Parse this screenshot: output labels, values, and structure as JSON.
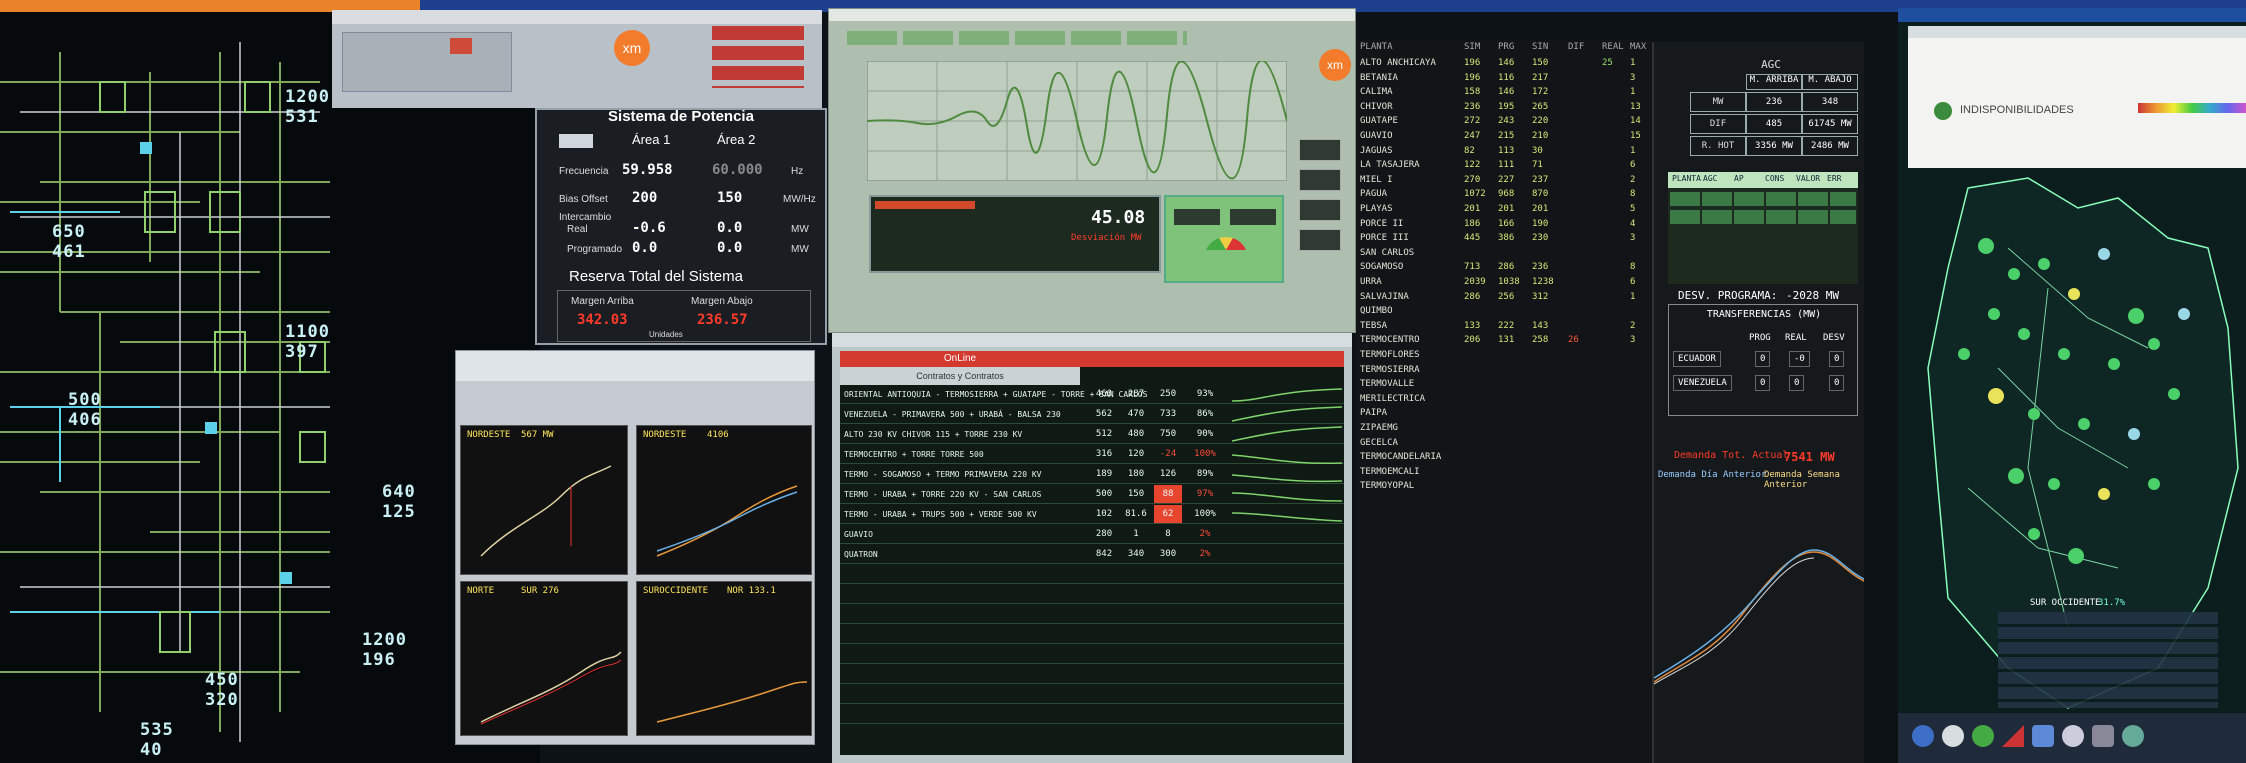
{
  "sld": {
    "readouts": [
      {
        "top": "1200",
        "bot": "531"
      },
      {
        "top": "650",
        "bot": "461"
      },
      {
        "top": "1100",
        "bot": "397"
      },
      {
        "top": "500",
        "bot": "406"
      },
      {
        "top": "640",
        "bot": "125"
      },
      {
        "top": "1200",
        "bot": "196"
      },
      {
        "top": "450",
        "bot": "320"
      },
      {
        "top": "535",
        "bot": "40"
      }
    ]
  },
  "agc_panel": {
    "title": "Sistema de Potencia",
    "area1": "Área 1",
    "area2": "Área 2",
    "freq_label": "Frecuencia",
    "freq_area1": "59.958",
    "freq_area2": "60.000",
    "freq_unit": "Hz",
    "bias_label": "Bias Offset",
    "bias_area1": "200",
    "bias_area2": "150",
    "bias_unit": "MW/Hz",
    "inter_label": "Intercambio",
    "real_label": "Real",
    "real_area1": "-0.6",
    "real_area2": "0.0",
    "real_unit": "MW",
    "prog_label": "Programado",
    "prog_area1": "0.0",
    "prog_area2": "0.0",
    "prog_unit": "MW",
    "reserve_title": "Reserva Total del Sistema",
    "margin_up_label": "Margen Arriba",
    "margin_down_label": "Margen Abajo",
    "margin_up": "342.03",
    "margin_down": "236.57",
    "footer": "Unidades"
  },
  "trend_window": {
    "logo": "xm",
    "readout": "45.08",
    "readout_sub": "Desviación MW"
  },
  "online_window": {
    "title": "OnLine",
    "subtitle": "Contratos y Contratos",
    "rows": [
      {
        "label": "ORIENTAL ANTIOQUIA - TERMOSIERRA + GUATAPE - TORRE + SAN CARLOS",
        "c1": "460",
        "c2": "287",
        "c3": "250",
        "c4": "93%"
      },
      {
        "label": "VENEZUELA - PRIMAVERA 500 + URABÁ - BALSA 230",
        "c1": "562",
        "c2": "470",
        "c3": "733",
        "c4": "86%"
      },
      {
        "label": "ALTO 230 KV CHIVOR 115 + TORRE 230 KV",
        "c1": "512",
        "c2": "480",
        "c3": "750",
        "c4": "90%"
      },
      {
        "label": "TERMOCENTRO + TORRE TORRE 500",
        "c1": "316",
        "c2": "120",
        "c3": "-24",
        "c4": "100%"
      },
      {
        "label": "TERMO - SOGAMOSO + TERMO PRIMAVERA 220 KV",
        "c1": "189",
        "c2": "180",
        "c3": "126",
        "c4": "89%"
      },
      {
        "label": "TERMO - URABA + TORRE 220 KV - SAN CARLOS",
        "c1": "500",
        "c2": "150",
        "c3": "88",
        "c4": "97%"
      },
      {
        "label": "TERMO - URABA + TRUPS 500 + VERDE 500 KV",
        "c1": "102",
        "c2": "81.6",
        "c3": "62",
        "c4": "100%"
      },
      {
        "label": "GUAVIO",
        "c1": "280",
        "c2": "1",
        "c3": "8",
        "c4": "2%"
      },
      {
        "label": "QUATRON",
        "c1": "842",
        "c2": "340",
        "c3": "300",
        "c4": "2%"
      }
    ]
  },
  "charts_window": {
    "labels": [
      "NORDESTE",
      "NORDESTE",
      "NORTE",
      "SUROCCIDENTE"
    ],
    "values": [
      "567 MW",
      "4106",
      "SUR 276",
      "NOR 133.1"
    ]
  },
  "plants_table": {
    "headers": [
      "PLANTA",
      "SIM",
      "PRG",
      "SIN",
      "DIF",
      "REAL",
      "MAX"
    ],
    "rows": [
      [
        "ALTO ANCHICAYA",
        "196",
        "146",
        "150",
        "",
        "25",
        "1"
      ],
      [
        "BETANIA",
        "196",
        "116",
        "217",
        "",
        "",
        "3"
      ],
      [
        "CALIMA",
        "158",
        "146",
        "172",
        "",
        "",
        "1"
      ],
      [
        "CHIVOR",
        "236",
        "195",
        "265",
        "",
        "",
        "13"
      ],
      [
        "GUATAPE",
        "272",
        "243",
        "220",
        "",
        "",
        "14"
      ],
      [
        "GUAVIO",
        "247",
        "215",
        "210",
        "",
        "",
        "15"
      ],
      [
        "JAGUAS",
        "82",
        "113",
        "30",
        "",
        "",
        "1"
      ],
      [
        "LA TASAJERA",
        "122",
        "111",
        "71",
        "",
        "",
        "6"
      ],
      [
        "MIEL I",
        "270",
        "227",
        "237",
        "",
        "",
        "2"
      ],
      [
        "PAGUA",
        "1072",
        "968",
        "870",
        "",
        "",
        "8"
      ],
      [
        "PLAYAS",
        "201",
        "201",
        "201",
        "",
        "",
        "5"
      ],
      [
        "PORCE II",
        "186",
        "166",
        "190",
        "",
        "",
        "4"
      ],
      [
        "PORCE III",
        "445",
        "386",
        "230",
        "",
        "",
        "3"
      ],
      [
        "SAN CARLOS",
        "",
        "",
        "",
        "",
        "",
        ""
      ],
      [
        "SOGAMOSO",
        "713",
        "286",
        "236",
        "",
        "",
        "8"
      ],
      [
        "URRA",
        "2039",
        "1038",
        "1238",
        "",
        "",
        "6"
      ],
      [
        "SALVAJINA",
        "286",
        "256",
        "312",
        "",
        "",
        "1"
      ],
      [
        "QUIMBO",
        "",
        "",
        "",
        "",
        "",
        ""
      ],
      [
        "TEBSA",
        "133",
        "222",
        "143",
        "",
        "",
        "2"
      ],
      [
        "TERMOCENTRO",
        "206",
        "131",
        "258",
        "26",
        "",
        "3"
      ],
      [
        "TERMOFLORES",
        "",
        "",
        "",
        "",
        "",
        ""
      ],
      [
        "TERMOSIERRA",
        "",
        "",
        "",
        "",
        "",
        ""
      ],
      [
        "TERMOVALLE",
        "",
        "",
        "",
        "",
        "",
        ""
      ],
      [
        "MERILECTRICA",
        "",
        "",
        "",
        "",
        "",
        ""
      ],
      [
        "PAIPA",
        "",
        "",
        "",
        "",
        "",
        ""
      ],
      [
        "ZIPAEMG",
        "",
        "",
        "",
        "",
        "",
        ""
      ],
      [
        "GECELCA",
        "",
        "",
        "",
        "",
        "",
        ""
      ],
      [
        "TERMOCANDELARIA",
        "",
        "",
        "",
        "",
        "",
        ""
      ],
      [
        "TERMOEMCALI",
        "",
        "",
        "",
        "",
        "",
        ""
      ],
      [
        "TERMOYOPAL",
        "",
        "",
        "",
        "",
        "",
        ""
      ]
    ]
  },
  "right_panel": {
    "agc_title": "AGC",
    "agc_cols": [
      "M. ARRIBA",
      "M. ABAJO"
    ],
    "agc_rows": [
      {
        "label": "MW",
        "a": "236",
        "b": "348"
      },
      {
        "label": "DIF",
        "a": "485",
        "b": "61745 MW"
      },
      {
        "label": "R. HOT",
        "a": "3356 MW",
        "b": "2486 MW"
      }
    ],
    "plant_cols": [
      "PLANTA",
      "AGC",
      "AP",
      "CONS",
      "VALOR",
      "ERR"
    ],
    "desv_label": "DESV. PROGRAMA:",
    "desv_value": "-2028 MW",
    "transfer_title": "TRANSFERENCIAS (MW)",
    "transfer_cols": [
      "PROG",
      "REAL",
      "DESV"
    ],
    "transfer_rows": [
      {
        "label": "ECUADOR",
        "prog": "0",
        "real": "-0",
        "desv": "0"
      },
      {
        "label": "VENEZUELA",
        "prog": "0",
        "real": "0",
        "desv": "0"
      }
    ],
    "demand_label": "Demanda Tot. Actual",
    "demand_value": "7541 MW",
    "demand_prev": "Demanda Día Anterior",
    "demand_prev2": "Demanda Semana Anterior"
  },
  "map_panel": {
    "title": "INDISPONIBILIDADES",
    "legend_title": "SUR OCCIDENTE",
    "legend_value": "31.7%"
  }
}
